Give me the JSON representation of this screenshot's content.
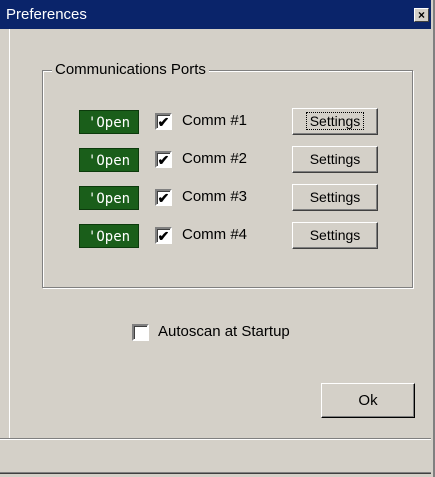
{
  "window": {
    "title": "Preferences",
    "close_label": "×"
  },
  "ports_group": {
    "label": "Communications Ports",
    "ports": [
      {
        "status": "'Open",
        "checked": "✔",
        "label": "Comm #1",
        "settings_label": "Settings"
      },
      {
        "status": "'Open",
        "checked": "✔",
        "label": "Comm #2",
        "settings_label": "Settings"
      },
      {
        "status": "'Open",
        "checked": "✔",
        "label": "Comm #3",
        "settings_label": "Settings"
      },
      {
        "status": "'Open",
        "checked": "✔",
        "label": "Comm #4",
        "settings_label": "Settings"
      }
    ]
  },
  "autoscan": {
    "label": "Autoscan at Startup",
    "checked": ""
  },
  "ok_button": {
    "label": "Ok"
  }
}
